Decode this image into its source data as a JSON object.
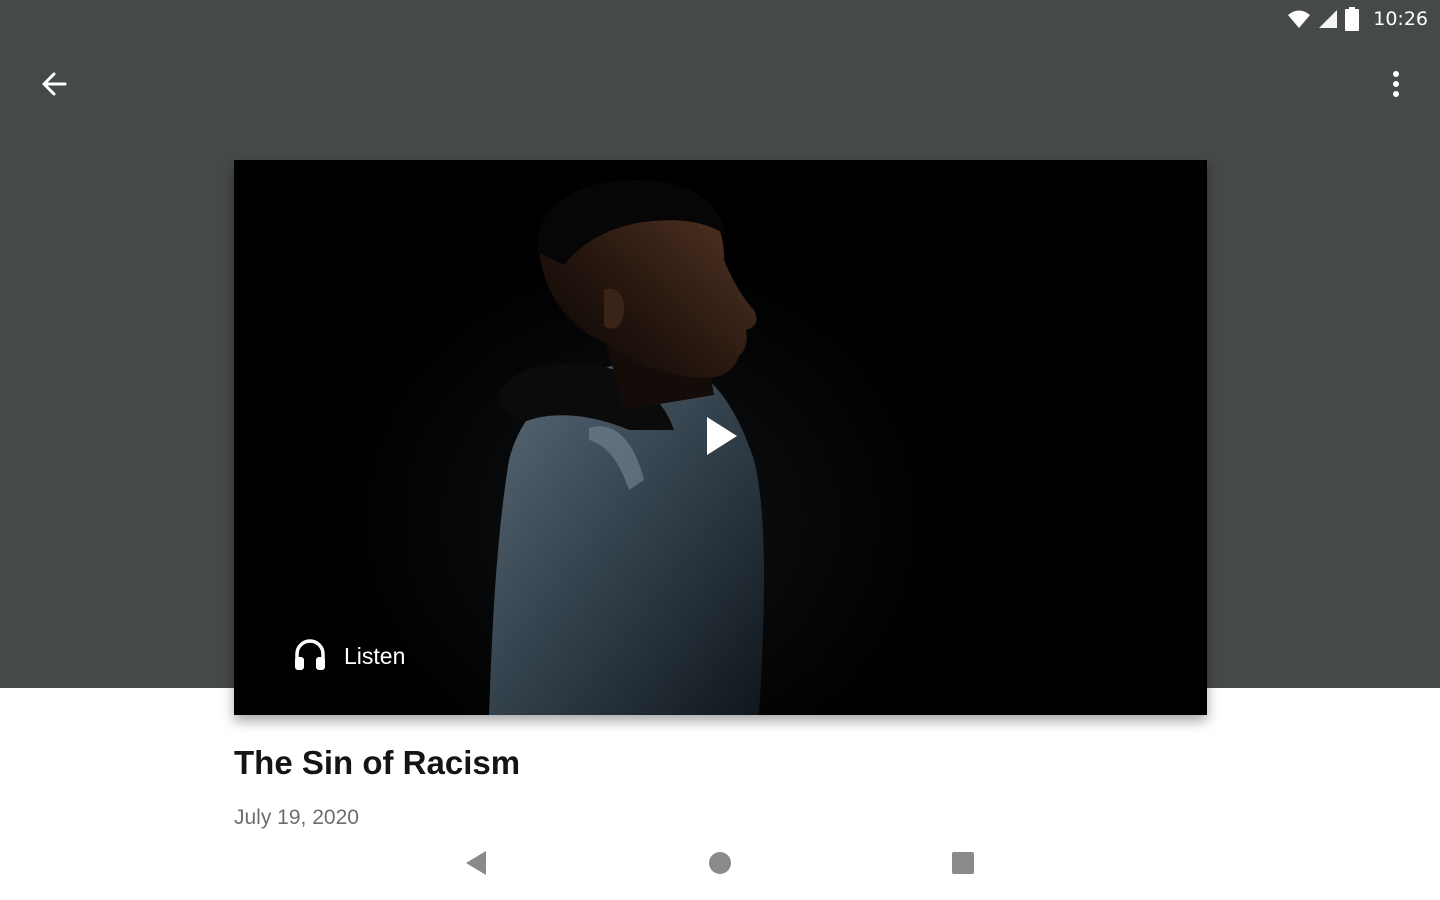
{
  "status_bar": {
    "time": "10:26",
    "icons": [
      "wifi-icon",
      "signal-icon",
      "battery-icon"
    ]
  },
  "app_bar": {
    "back_icon": "arrow-left-icon",
    "menu_icon": "more-vertical-icon"
  },
  "media": {
    "play_icon": "play-icon",
    "listen_icon": "headphones-icon",
    "listen_label": "Listen"
  },
  "content": {
    "title": "The Sin of Racism",
    "date": "July 19, 2020"
  },
  "nav_bar": {
    "back_icon": "triangle-back-icon",
    "home_icon": "circle-home-icon",
    "recents_icon": "square-recents-icon"
  },
  "colors": {
    "header_background": "#454947",
    "media_background": "#000000",
    "title_text": "#141414",
    "date_text": "#6e6e6e",
    "nav_icons": "#8a8a8a"
  }
}
